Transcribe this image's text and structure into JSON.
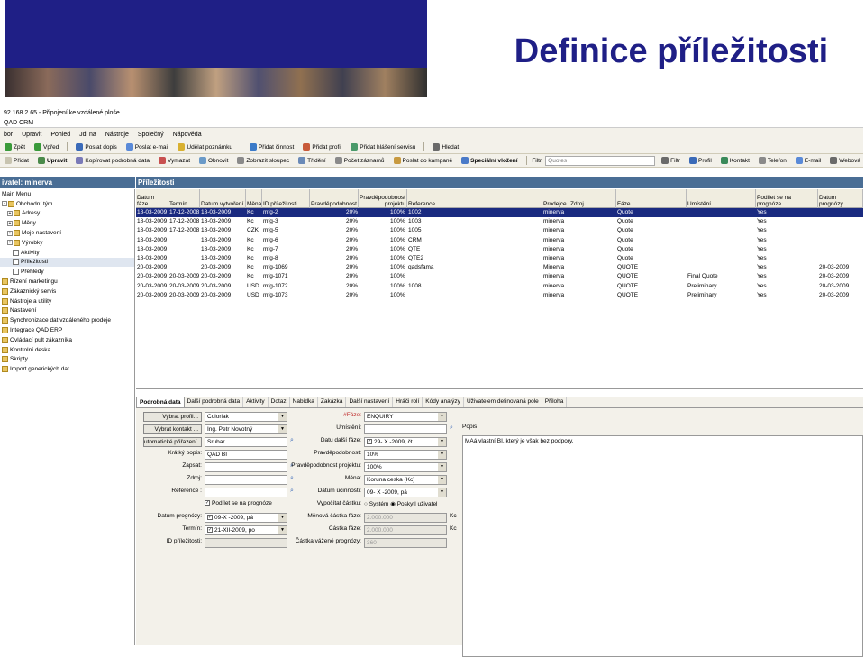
{
  "slide": {
    "title": "Definice příležitosti"
  },
  "window": {
    "rdp_title": "92.168.2.65 - Připojení ke vzdálené ploše",
    "app_title": "QAD CRM"
  },
  "menu": [
    "bor",
    "Upravit",
    "Pohled",
    "Jdi na",
    "Nástroje",
    "Společný",
    "Nápověda"
  ],
  "toolbar1": [
    {
      "label": "Zpět",
      "icon": "back-arrow-icon"
    },
    {
      "label": "Vpřed",
      "icon": "forward-arrow-icon"
    },
    {
      "label": "Poslat dopis",
      "icon": "letter-icon"
    },
    {
      "label": "Poslat e-mail",
      "icon": "email-icon"
    },
    {
      "label": "Udělat poznámku",
      "icon": "note-icon"
    },
    {
      "label": "Přidat činnost",
      "icon": "activity-icon"
    },
    {
      "label": "Přidat profil",
      "icon": "profile-icon"
    },
    {
      "label": "Přidat hlášení servisu",
      "icon": "service-icon"
    },
    {
      "label": "Hledat",
      "icon": "search-icon"
    }
  ],
  "toolbar2": {
    "buttons": [
      "Přidat",
      "Upravit",
      "Kopírovat podrobná data",
      "Vymazat",
      "Obnovit",
      "Zobrazit sloupec",
      "Třídění",
      "Počet záznamů",
      "Poslat do kampaně",
      "Speciální vložení"
    ],
    "filter_label": "Filtr",
    "filter_value": "Quotes",
    "right_buttons": [
      "Filtr",
      "Profil",
      "Kontakt",
      "Telefon",
      "E-mail",
      "Webová"
    ]
  },
  "nav": {
    "header": "ivatel: minerva",
    "items": [
      {
        "label": "Main Menu",
        "level": 0,
        "type": "root"
      },
      {
        "label": "Obchodní tým",
        "level": 0,
        "type": "folder",
        "expander": "-"
      },
      {
        "label": "Adresy",
        "level": 1,
        "type": "folder",
        "expander": "+"
      },
      {
        "label": "Měny",
        "level": 1,
        "type": "folder",
        "expander": "+"
      },
      {
        "label": "Moje nastavení",
        "level": 1,
        "type": "folder",
        "expander": "+"
      },
      {
        "label": "Výrobky",
        "level": 1,
        "type": "folder",
        "expander": "+"
      },
      {
        "label": "Aktivity",
        "level": 2,
        "type": "doc"
      },
      {
        "label": "Příležitosti",
        "level": 2,
        "type": "doc",
        "selected": true
      },
      {
        "label": "Přehledy",
        "level": 2,
        "type": "doc"
      },
      {
        "label": "Řízení marketingu",
        "level": 0,
        "type": "folder"
      },
      {
        "label": "Zákaznický servis",
        "level": 0,
        "type": "folder"
      },
      {
        "label": "Nástroje a utility",
        "level": 0,
        "type": "folder"
      },
      {
        "label": "Nastavení",
        "level": 0,
        "type": "folder"
      },
      {
        "label": "Synchronizace dat vzdáleného prodeje",
        "level": 0,
        "type": "folder"
      },
      {
        "label": "Integrace QAD ERP",
        "level": 0,
        "type": "folder"
      },
      {
        "label": "Ovládací pult zákazníka",
        "level": 0,
        "type": "folder"
      },
      {
        "label": "Kontrolní deska",
        "level": 0,
        "type": "folder"
      },
      {
        "label": "Skripty",
        "level": 0,
        "type": "folder"
      },
      {
        "label": "Import generických dat",
        "level": 0,
        "type": "folder"
      }
    ]
  },
  "grid": {
    "header": "Příležitosti",
    "columns": [
      "Datum fáze",
      "Termín",
      "Datum vytvoření",
      "Měna",
      "ID příležitosti",
      "Pravděpodobnost",
      "Pravděpodobnost projektu",
      "Reference",
      "Prodejce",
      "Zdroj",
      "Fáze",
      "Umístění",
      "Podílet se na prognóze",
      "Datum prognózy"
    ],
    "rows": [
      [
        "18-03-2009",
        "17-12-2008",
        "18-03-2009",
        "Kc",
        "mfg-2",
        "20%",
        "100%",
        "1002",
        "minerva",
        "",
        "Quote",
        "",
        "Yes",
        ""
      ],
      [
        "18-03-2009",
        "17-12-2008",
        "18-03-2009",
        "Kc",
        "mfg-3",
        "20%",
        "100%",
        "1003",
        "minerva",
        "",
        "Quote",
        "",
        "Yes",
        ""
      ],
      [
        "18-03-2009",
        "17-12-2008",
        "18-03-2009",
        "CZK",
        "mfg-5",
        "20%",
        "100%",
        "1005",
        "minerva",
        "",
        "Quote",
        "",
        "Yes",
        ""
      ],
      [
        "18-03-2009",
        "",
        "18-03-2009",
        "Kc",
        "mfg-6",
        "20%",
        "100%",
        "CRM",
        "minerva",
        "",
        "Quote",
        "",
        "Yes",
        ""
      ],
      [
        "18-03-2009",
        "",
        "18-03-2009",
        "Kc",
        "mfg-7",
        "20%",
        "100%",
        "QTE",
        "minerva",
        "",
        "Quote",
        "",
        "Yes",
        ""
      ],
      [
        "18-03-2009",
        "",
        "18-03-2009",
        "Kc",
        "mfg-8",
        "20%",
        "100%",
        "QTE2",
        "minerva",
        "",
        "Quote",
        "",
        "Yes",
        ""
      ],
      [
        "20-03-2009",
        "",
        "20-03-2009",
        "Kc",
        "mfg-1069",
        "20%",
        "100%",
        "qadsfama",
        "Minerva",
        "",
        "QUOTE",
        "",
        "Yes",
        "20-03-2009"
      ],
      [
        "20-03-2009",
        "20-03-2009",
        "20-03-2009",
        "Kc",
        "mfg-1071",
        "20%",
        "100%",
        "",
        "minerva",
        "",
        "QUOTE",
        "Final Quote",
        "Yes",
        "20-03-2009"
      ],
      [
        "20-03-2009",
        "20-03-2009",
        "20-03-2009",
        "USD",
        "mfg-1072",
        "20%",
        "100%",
        "1008",
        "minerva",
        "",
        "QUOTE",
        "Preliminary",
        "Yes",
        "20-03-2009"
      ],
      [
        "20-03-2009",
        "20-03-2009",
        "20-03-2009",
        "USD",
        "mfg-1073",
        "20%",
        "100%",
        "",
        "minerva",
        "",
        "QUOTE",
        "Preliminary",
        "Yes",
        "20-03-2009"
      ]
    ]
  },
  "detail": {
    "tabs": [
      "Podrobná data",
      "Další podrobná data",
      "Aktivity",
      "Dotaz",
      "Nabídka",
      "Zakázka",
      "Další nastavení",
      "Hráči rolí",
      "Kódy analýzy",
      "Uživatelem definovaná pole",
      "Příloha"
    ],
    "left": {
      "vybrat_profil": {
        "label": "Vybrat profil...",
        "value": "Colorlak"
      },
      "vybrat_kontakt": {
        "label": "Vybrat kontakt ...",
        "value": "Ing. Petr Novotný"
      },
      "auto_prirazeni": {
        "label": "utomatické přiřazení ...",
        "value": "Srubar"
      },
      "kratky_popis": {
        "label": "Krátký popis:",
        "value": "QAD BI"
      },
      "zapsat": {
        "label": "Zapsat:",
        "value": ""
      },
      "zdroj": {
        "label": "Zdroj:",
        "value": ""
      },
      "reference": {
        "label": "Reference :",
        "value": ""
      },
      "podilet": {
        "label": "Podílet se na prognóze"
      },
      "datum_prognozy": {
        "label": "Datum prognózy:",
        "value": "09-X -2009, pá"
      },
      "termin": {
        "label": "Termín:",
        "value": "21-XII-2009, po"
      },
      "id_prilezitosti": {
        "label": "ID příležitosti:",
        "value": ""
      }
    },
    "middle": {
      "faze": {
        "label": "#Fáze:",
        "value": "ENQUIRY"
      },
      "umisteni": {
        "label": "Umístění:",
        "value": ""
      },
      "datum_dalsi_faze": {
        "label": "Datu další fáze:",
        "value": "29- X -2009, čt"
      },
      "pravdepodobnost": {
        "label": "Pravděpodobnost:",
        "value": "10%"
      },
      "pravdepodobnost_projektu": {
        "label": "Pravděpodobnost projektu:",
        "value": "100%"
      },
      "mena": {
        "label": "Měna:",
        "value": "Koruna ceska (Kc)"
      },
      "datum_ucinnosti": {
        "label": "Datum účinnosti:",
        "value": "09- X -2009, pá"
      },
      "vypocitat": {
        "label": "Vypočítat částku:",
        "opt1": "Systém",
        "opt2": "Poskytl uživatel"
      },
      "menova_castka": {
        "label": "Měnová částka fáze:",
        "value": "2.000.000",
        "unit": "Kc"
      },
      "castka_faze": {
        "label": "Částka fáze:",
        "value": "2.000.000",
        "unit": "Kc"
      },
      "castka_vazene": {
        "label": "Částka vážené prognózy:",
        "value": "360"
      }
    },
    "notes": {
      "label": "Popis",
      "value": "MAá vlastní BI, který je však bez podpory."
    }
  }
}
